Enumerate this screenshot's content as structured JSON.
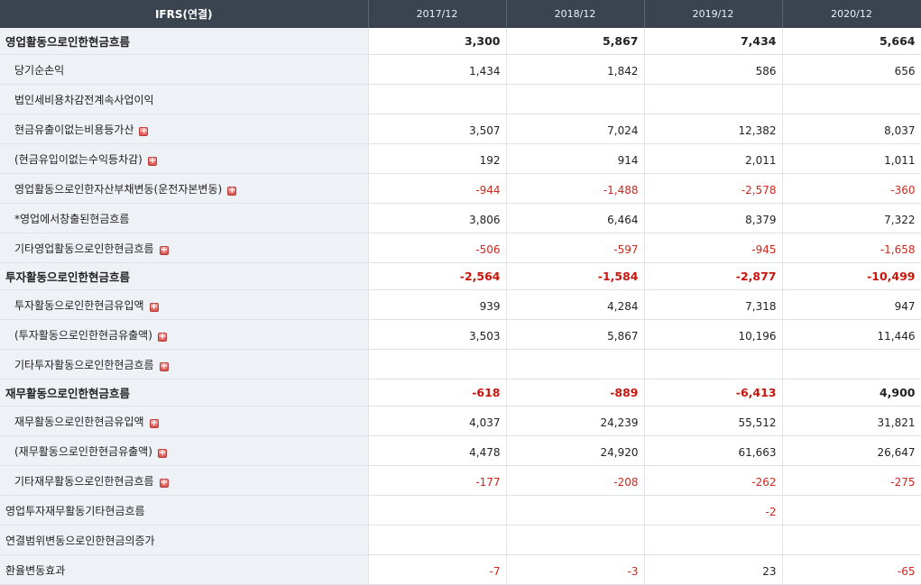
{
  "header": {
    "label": "IFRS(연결)",
    "years": [
      "2017/12",
      "2018/12",
      "2019/12",
      "2020/12"
    ]
  },
  "rows": [
    {
      "label": "영업활동으로인한현금흐름",
      "level": "main",
      "expand": false,
      "values": [
        "3,300",
        "5,867",
        "7,434",
        "5,664"
      ]
    },
    {
      "label": "당기순손익",
      "level": "sub",
      "expand": false,
      "values": [
        "1,434",
        "1,842",
        "586",
        "656"
      ]
    },
    {
      "label": "법인세비용차감전계속사업이익",
      "level": "sub",
      "expand": false,
      "values": [
        "",
        "",
        "",
        ""
      ]
    },
    {
      "label": "현금유출이없는비용등가산",
      "level": "sub",
      "expand": true,
      "values": [
        "3,507",
        "7,024",
        "12,382",
        "8,037"
      ]
    },
    {
      "label": "(현금유입이없는수익등차감)",
      "level": "sub",
      "expand": true,
      "values": [
        "192",
        "914",
        "2,011",
        "1,011"
      ]
    },
    {
      "label": "영업활동으로인한자산부채변동(운전자본변동)",
      "level": "sub",
      "expand": true,
      "values": [
        "-944",
        "-1,488",
        "-2,578",
        "-360"
      ]
    },
    {
      "label": "*영업에서창출된현금흐름",
      "level": "sub",
      "expand": false,
      "values": [
        "3,806",
        "6,464",
        "8,379",
        "7,322"
      ]
    },
    {
      "label": "기타영업활동으로인한현금흐름",
      "level": "sub",
      "expand": true,
      "values": [
        "-506",
        "-597",
        "-945",
        "-1,658"
      ]
    },
    {
      "label": "투자활동으로인한현금흐름",
      "level": "main",
      "expand": false,
      "values": [
        "-2,564",
        "-1,584",
        "-2,877",
        "-10,499"
      ]
    },
    {
      "label": "투자활동으로인한현금유입액",
      "level": "sub",
      "expand": true,
      "values": [
        "939",
        "4,284",
        "7,318",
        "947"
      ]
    },
    {
      "label": "(투자활동으로인한현금유출액)",
      "level": "sub",
      "expand": true,
      "values": [
        "3,503",
        "5,867",
        "10,196",
        "11,446"
      ]
    },
    {
      "label": "기타투자활동으로인한현금흐름",
      "level": "sub",
      "expand": true,
      "values": [
        "",
        "",
        "",
        ""
      ]
    },
    {
      "label": "재무활동으로인한현금흐름",
      "level": "main",
      "expand": false,
      "values": [
        "-618",
        "-889",
        "-6,413",
        "4,900"
      ]
    },
    {
      "label": "재무활동으로인한현금유입액",
      "level": "sub",
      "expand": true,
      "values": [
        "4,037",
        "24,239",
        "55,512",
        "31,821"
      ]
    },
    {
      "label": "(재무활동으로인한현금유출액)",
      "level": "sub",
      "expand": true,
      "values": [
        "4,478",
        "24,920",
        "61,663",
        "26,647"
      ]
    },
    {
      "label": "기타재무활동으로인한현금흐름",
      "level": "sub",
      "expand": true,
      "values": [
        "-177",
        "-208",
        "-262",
        "-275"
      ]
    },
    {
      "label": "영업투자재무활동기타현금흐름",
      "level": "plain",
      "expand": false,
      "values": [
        "",
        "",
        "-2",
        ""
      ]
    },
    {
      "label": "연결범위변동으로인한현금의증가",
      "level": "plain",
      "expand": false,
      "values": [
        "",
        "",
        "",
        ""
      ]
    },
    {
      "label": "환율변동효과",
      "level": "plain",
      "expand": false,
      "values": [
        "-7",
        "-3",
        "23",
        "-65"
      ]
    }
  ]
}
